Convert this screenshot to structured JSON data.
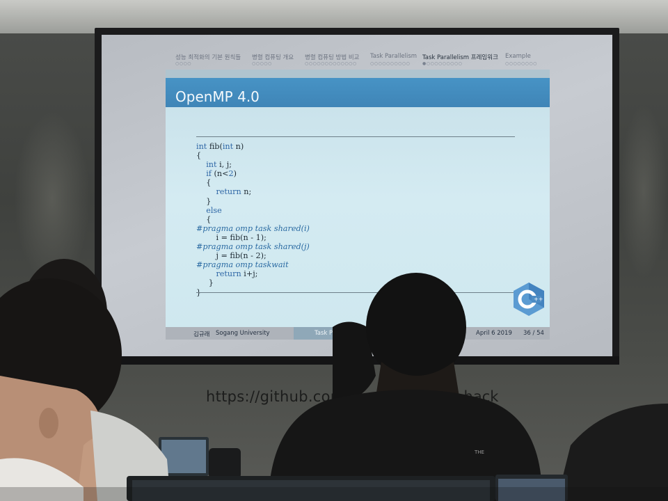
{
  "wall": {
    "url_start": "https://github.com",
    "url_end": "s-hack"
  },
  "slide": {
    "nav": [
      {
        "label": "성능 최적화의 기본 원칙들",
        "dots": "○○○○",
        "active": false
      },
      {
        "label": "병렬 컴퓨팅 개요",
        "dots": "○○○○○",
        "active": false
      },
      {
        "label": "병렬 컴퓨팅 방법 비교",
        "dots": "○○○○○○○○○○○○○",
        "active": false
      },
      {
        "label": "Task Parallelism",
        "dots": "○○○○○○○○○○",
        "active": false
      },
      {
        "label": "Task Parallelism 프레임워크",
        "dots": "●○○○○○○○○○",
        "active": true
      },
      {
        "label": "Example",
        "dots": "○○○○○○○○",
        "active": false
      }
    ],
    "title": "OpenMP 4.0",
    "code": [
      "int fib(int n)",
      "{",
      "    int i, j;",
      "    if (n<2)",
      "    {",
      "        return n;",
      "    }",
      "    else",
      "    {",
      "#pragma omp task shared(i)",
      "        i = fib(n - 1);",
      "#pragma omp task shared(j)",
      "        j = fib(n - 2);",
      "#pragma omp taskwait",
      "        return i+j;",
      "     }",
      "}"
    ],
    "logo_icon": "cpp-logo-icon",
    "footer": {
      "author": "김규래",
      "affiliation": "Sogang University",
      "short_title": "Task Parallel C",
      "date": "April 6 2019",
      "page": "36 / 54"
    }
  },
  "colors": {
    "title_bar": "#4793c5",
    "slide_bg": "#d4ebf2",
    "keyword": "#2f67a6"
  }
}
